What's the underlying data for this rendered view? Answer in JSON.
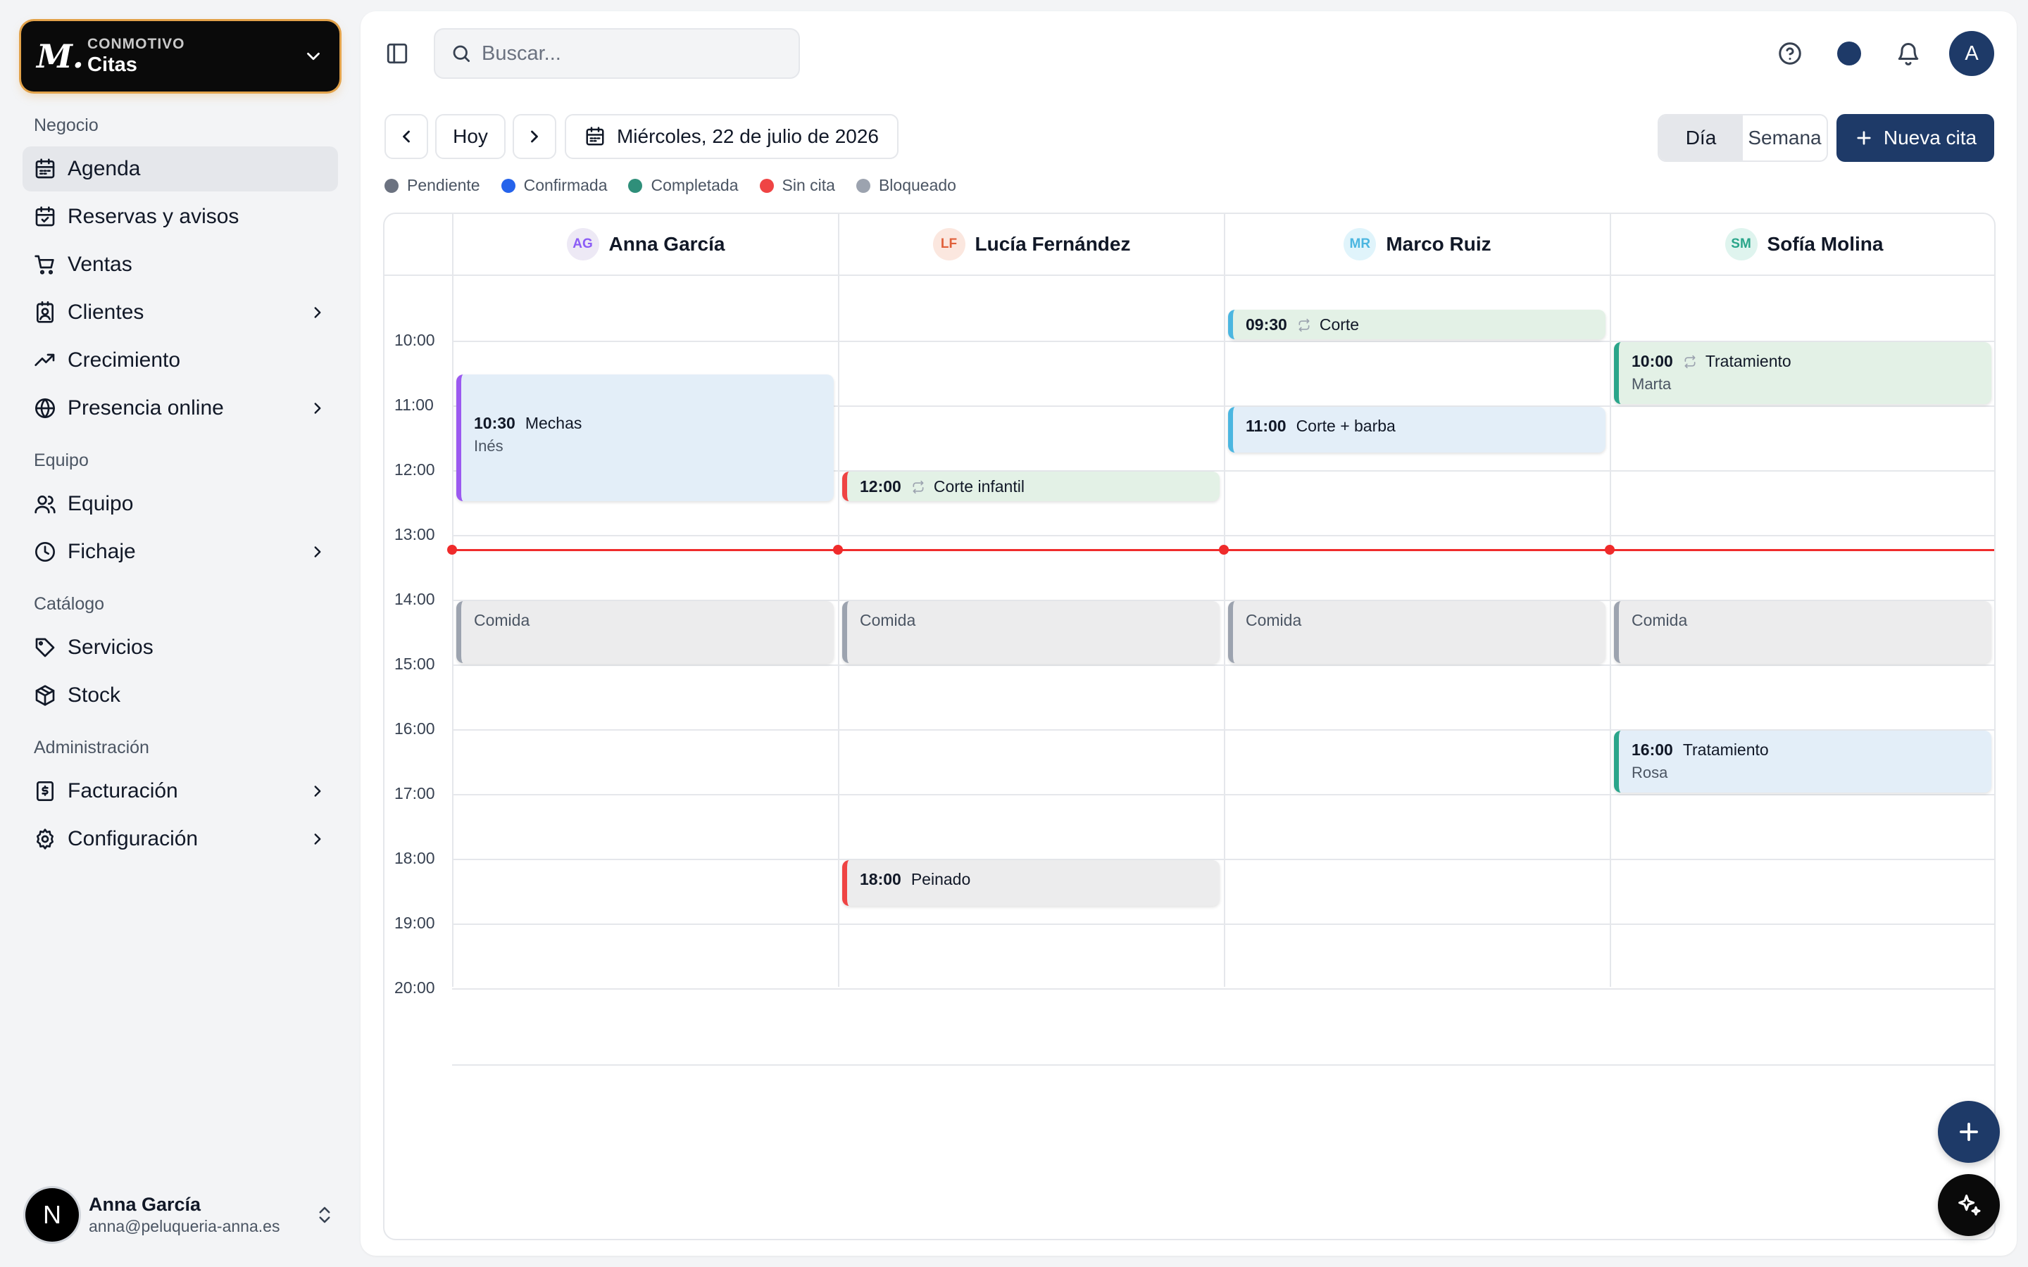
{
  "brand": {
    "logo": "M.",
    "org": "CONMOTIVO",
    "app": "Citas"
  },
  "sidebar": {
    "groups": [
      {
        "label": "Negocio"
      },
      {
        "label": "Equipo"
      },
      {
        "label": "Catálogo"
      },
      {
        "label": "Administración"
      }
    ],
    "items": [
      {
        "label": "Agenda",
        "icon": "calendar-icon",
        "active": true
      },
      {
        "label": "Reservas y avisos",
        "icon": "calendar-check-icon"
      },
      {
        "label": "Ventas",
        "icon": "cart-icon"
      },
      {
        "label": "Clientes",
        "icon": "contact-icon",
        "expandable": true
      },
      {
        "label": "Crecimiento",
        "icon": "trending-up-icon"
      },
      {
        "label": "Presencia online",
        "icon": "globe-icon",
        "expandable": true
      },
      {
        "label": "Equipo",
        "icon": "users-icon"
      },
      {
        "label": "Fichaje",
        "icon": "clock-icon",
        "expandable": true
      },
      {
        "label": "Servicios",
        "icon": "tag-icon"
      },
      {
        "label": "Stock",
        "icon": "package-icon"
      },
      {
        "label": "Facturación",
        "icon": "receipt-icon",
        "expandable": true
      },
      {
        "label": "Configuración",
        "icon": "gear-icon",
        "expandable": true
      }
    ],
    "user": {
      "initial": "N",
      "name": "Anna García",
      "email": "anna@peluqueria-anna.es"
    }
  },
  "topbar": {
    "search_placeholder": "Buscar...",
    "avatar_initial": "A",
    "theme_color": "#1e3a68"
  },
  "toolbar": {
    "today": "Hoy",
    "date": "Miércoles, 22 de julio de 2026",
    "views": [
      "Día",
      "Semana"
    ],
    "active_view": "Día",
    "new_appointment": "Nueva cita"
  },
  "legend": [
    {
      "label": "Pendiente",
      "color": "#6b7280"
    },
    {
      "label": "Confirmada",
      "color": "#2563eb"
    },
    {
      "label": "Completada",
      "color": "#2f8f7a"
    },
    {
      "label": "Sin cita",
      "color": "#ef4444"
    },
    {
      "label": "Bloqueado",
      "color": "#9ca3af"
    }
  ],
  "calendar": {
    "start_hour": 9.0,
    "hours": [
      "10:00",
      "11:00",
      "12:00",
      "13:00",
      "14:00",
      "15:00",
      "16:00",
      "17:00",
      "18:00",
      "19:00",
      "20:00"
    ],
    "now": "13:13",
    "staff": [
      {
        "initials": "AG",
        "name": "Anna García",
        "avatar_bg": "#ede9f5",
        "avatar_fg": "#8b5cf6"
      },
      {
        "initials": "LF",
        "name": "Lucía Fernández",
        "avatar_bg": "#fbe7df",
        "avatar_fg": "#e0603a"
      },
      {
        "initials": "MR",
        "name": "Marco Ruiz",
        "avatar_bg": "#e0f4fb",
        "avatar_fg": "#4bb6e0"
      },
      {
        "initials": "SM",
        "name": "Sofía Molina",
        "avatar_bg": "#dff4ee",
        "avatar_fg": "#2aa58a"
      }
    ],
    "events": [
      {
        "col": 2,
        "time": "09:30",
        "title": "Corte",
        "client": "",
        "start": 9.5,
        "end": 10.0,
        "bg": "#e3f1e6",
        "accent": "#4bb6e0",
        "recurring": true
      },
      {
        "col": 3,
        "time": "10:00",
        "title": "Tratamiento",
        "client": "Marta",
        "start": 10.0,
        "end": 11.0,
        "bg": "#e3f1e6",
        "accent": "#2aa58a",
        "recurring": true
      },
      {
        "col": 0,
        "time": "10:30",
        "title": "Mechas",
        "client": "Inés",
        "start": 10.5,
        "end": 12.5,
        "bg": "#e3eef8",
        "accent": "#9b59f0",
        "recurring": false
      },
      {
        "col": 2,
        "time": "11:00",
        "title": "Corte + barba",
        "client": "",
        "start": 11.0,
        "end": 11.75,
        "bg": "#e3eef8",
        "accent": "#4bb6e0",
        "recurring": false
      },
      {
        "col": 1,
        "time": "12:00",
        "title": "Corte infantil",
        "client": "",
        "start": 12.0,
        "end": 12.5,
        "bg": "#e3f1e6",
        "accent": "#ef4444",
        "recurring": true
      },
      {
        "col": 0,
        "time": "",
        "title": "Comida",
        "client": "",
        "start": 14.0,
        "end": 15.0,
        "bg": "#ececed",
        "accent": "#9ca3af",
        "blocked": true
      },
      {
        "col": 1,
        "time": "",
        "title": "Comida",
        "client": "",
        "start": 14.0,
        "end": 15.0,
        "bg": "#ececed",
        "accent": "#9ca3af",
        "blocked": true
      },
      {
        "col": 2,
        "time": "",
        "title": "Comida",
        "client": "",
        "start": 14.0,
        "end": 15.0,
        "bg": "#ececed",
        "accent": "#9ca3af",
        "blocked": true
      },
      {
        "col": 3,
        "time": "",
        "title": "Comida",
        "client": "",
        "start": 14.0,
        "end": 15.0,
        "bg": "#ececed",
        "accent": "#9ca3af",
        "blocked": true
      },
      {
        "col": 3,
        "time": "16:00",
        "title": "Tratamiento",
        "client": "Rosa",
        "start": 16.0,
        "end": 17.0,
        "bg": "#e3eef8",
        "accent": "#2aa58a",
        "recurring": false
      },
      {
        "col": 1,
        "time": "18:00",
        "title": "Peinado",
        "client": "",
        "start": 18.0,
        "end": 18.75,
        "bg": "#ececed",
        "accent": "#ef4444",
        "recurring": false
      }
    ]
  },
  "colors": {
    "primary": "#1e3a68",
    "now_line": "#ef2b2b"
  }
}
